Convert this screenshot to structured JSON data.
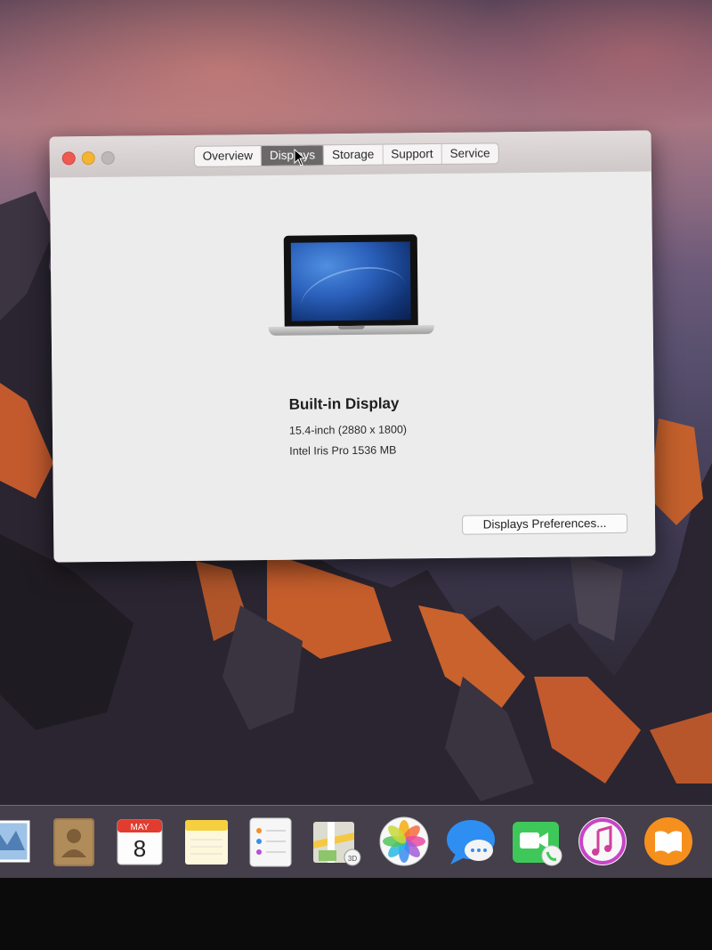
{
  "window": {
    "tabs": [
      "Overview",
      "Displays",
      "Storage",
      "Support",
      "Service"
    ],
    "active_tab": "Displays",
    "display": {
      "name": "Built-in Display",
      "size_resolution": "15.4-inch (2880 x 1800)",
      "graphics": "Intel Iris Pro 1536 MB"
    },
    "preferences_button": "Displays Preferences..."
  },
  "dock": {
    "items": [
      "mail-icon",
      "contacts-icon",
      "calendar-icon",
      "notes-icon",
      "reminders-icon",
      "maps-icon",
      "photos-icon",
      "messages-icon",
      "facetime-icon",
      "itunes-icon",
      "ibooks-icon"
    ],
    "calendar": {
      "month": "MAY",
      "day": "8"
    }
  }
}
